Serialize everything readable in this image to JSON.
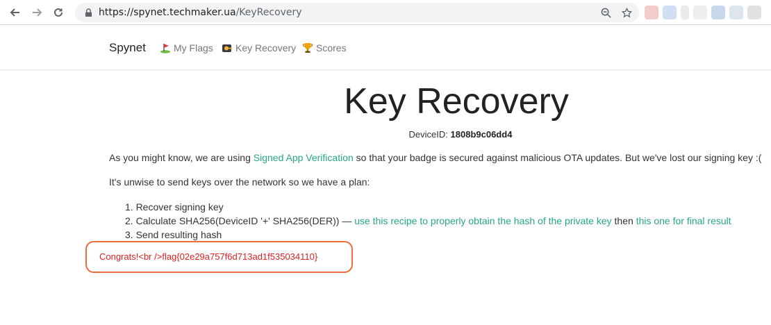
{
  "browser": {
    "url_host": "https://spynet.techmaker.ua",
    "url_path": "/KeyRecovery"
  },
  "nav": {
    "brand": "Spynet",
    "links": [
      {
        "label": "My Flags",
        "icon": "golf-flag-icon"
      },
      {
        "label": "Key Recovery",
        "icon": "key-badge-icon"
      },
      {
        "label": "Scores",
        "icon": "trophy-icon"
      }
    ]
  },
  "main": {
    "title": "Key Recovery",
    "device_label": "DeviceID:",
    "device_id": "1808b9c06dd4",
    "intro_prefix": "As you might know, we are using ",
    "intro_link": "Signed App Verification",
    "intro_suffix": " so that your badge is secured against malicious OTA updates. But we've lost our signing key :(",
    "plan_text": "It's unwise to send keys over the network so we have a plan:",
    "steps": {
      "step1": "1. Recover signing key",
      "step2_prefix": "2. Calculate SHA256(DeviceID '+' SHA256(DER)) — ",
      "step2_link1": "use this recipe to properly obtain the hash of the private key",
      "step2_middle": " then ",
      "step2_link2": "this one for final result",
      "step3": "3. Send resulting hash"
    },
    "result": "Congrats!<br />flag{02e29a757f6d713ad1f535034110}"
  },
  "colors": {
    "link": "#27a784",
    "flag_text": "#e02020",
    "flag_border": "#ec6a3b"
  }
}
